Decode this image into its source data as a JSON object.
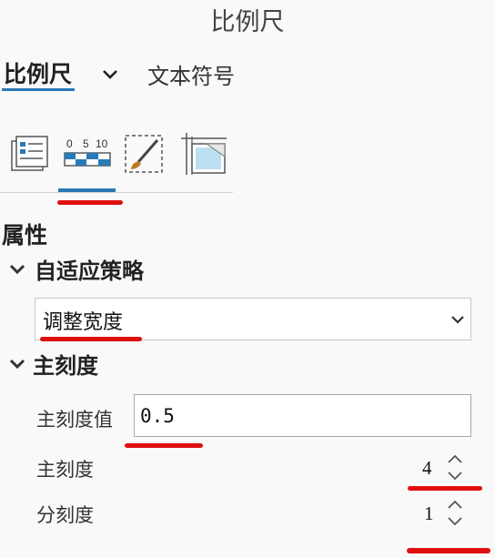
{
  "pane": {
    "title": "比例尺"
  },
  "tabs": {
    "active": "比例尺",
    "other": "文本符号"
  },
  "icon_toolbar": {
    "scale_bar_numbers": [
      "0",
      "5",
      "10"
    ],
    "items": [
      "options-icon",
      "scale-bar-icon",
      "symbol-brush-icon",
      "display-frame-icon"
    ],
    "active_index": 1
  },
  "properties": {
    "heading": "属性",
    "fitting_strategy": {
      "label": "自适应策略",
      "value": "调整宽度"
    },
    "divisions": {
      "label": "主刻度",
      "value_label": "主刻度值",
      "value": "0.5",
      "count_label": "主刻度",
      "count": "4",
      "subdiv_label": "分刻度",
      "subdiv": "1"
    }
  },
  "accent_color": "#2a7ab7",
  "annotation_color": "#e01010"
}
